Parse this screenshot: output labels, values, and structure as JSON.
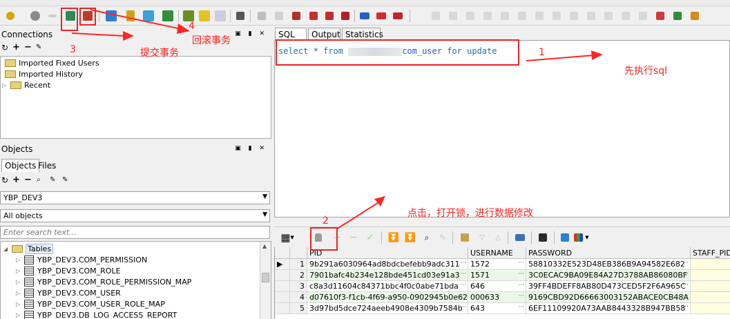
{
  "connections_panel": {
    "title": "Connections",
    "items": [
      "Imported Fixed Users",
      "Imported History",
      "Recent"
    ]
  },
  "objects_panel": {
    "title": "Objects",
    "tabs": [
      "Objects",
      "Files"
    ],
    "schema_value": "YBP_DEV3",
    "filter_value": "All objects",
    "search_placeholder": "Enter search text...",
    "tables_label": "Tables",
    "tables": [
      "YBP_DEV3.COM_PERMISSION",
      "YBP_DEV3.COM_ROLE",
      "YBP_DEV3.COM_ROLE_PERMISSION_MAP",
      "YBP_DEV3.COM_USER",
      "YBP_DEV3.COM_USER_ROLE_MAP",
      "YBP_DEV3.DB_LOG_ACCESS_REPORT"
    ]
  },
  "editor": {
    "tabs": [
      "SQL",
      "Output",
      "Statistics"
    ],
    "sql_kw1": "select",
    "sql_star": " * ",
    "sql_kw2": "from",
    "sql_table": "com_user",
    "sql_kw3": "for update"
  },
  "grid": {
    "columns": [
      "PID",
      "USERNAME",
      "PASSWORD",
      "STAFF_PID"
    ],
    "rows": [
      {
        "n": "1",
        "pid": "9b291a6030964ad8bdcbefebb9adc311",
        "username": "1572",
        "password": "58810332E523D48EB386B9A94582E682"
      },
      {
        "n": "2",
        "pid": "7901bafc4b234e128bde451cd03e91a3",
        "username": "1571",
        "password": "3C0ECAC9BA09E84A27D3788AB86080BF"
      },
      {
        "n": "3",
        "pid": "c8a3d11604c84371bbc4f0c0abe71bda",
        "username": "646",
        "password": "39FF4BDEFF8AB80D473CED5F2F6A965C"
      },
      {
        "n": "4",
        "pid": "d07610f3-f1cb-4f69-a950-0902945b0e62",
        "username": "000633",
        "password": "9169CBD92D66663003152ABACE0CB48A"
      },
      {
        "n": "5",
        "pid": "3d97bd5dce724aeeb4908e4309b7584b",
        "username": "643",
        "password": "6EF11109920A73AAB8443328B947BB58"
      }
    ]
  },
  "annotations": {
    "n1": "1",
    "t1": "先执行sql",
    "n2": "2",
    "t2": "点击，打开锁，进行数据修改",
    "n3": "3",
    "t3": "提交事务",
    "n4": "4",
    "t4": "回滚事务"
  },
  "colors": {
    "annotation": "#ff2020",
    "sql_text": "#2a52c9",
    "alt_row": "#e9f9e6"
  }
}
